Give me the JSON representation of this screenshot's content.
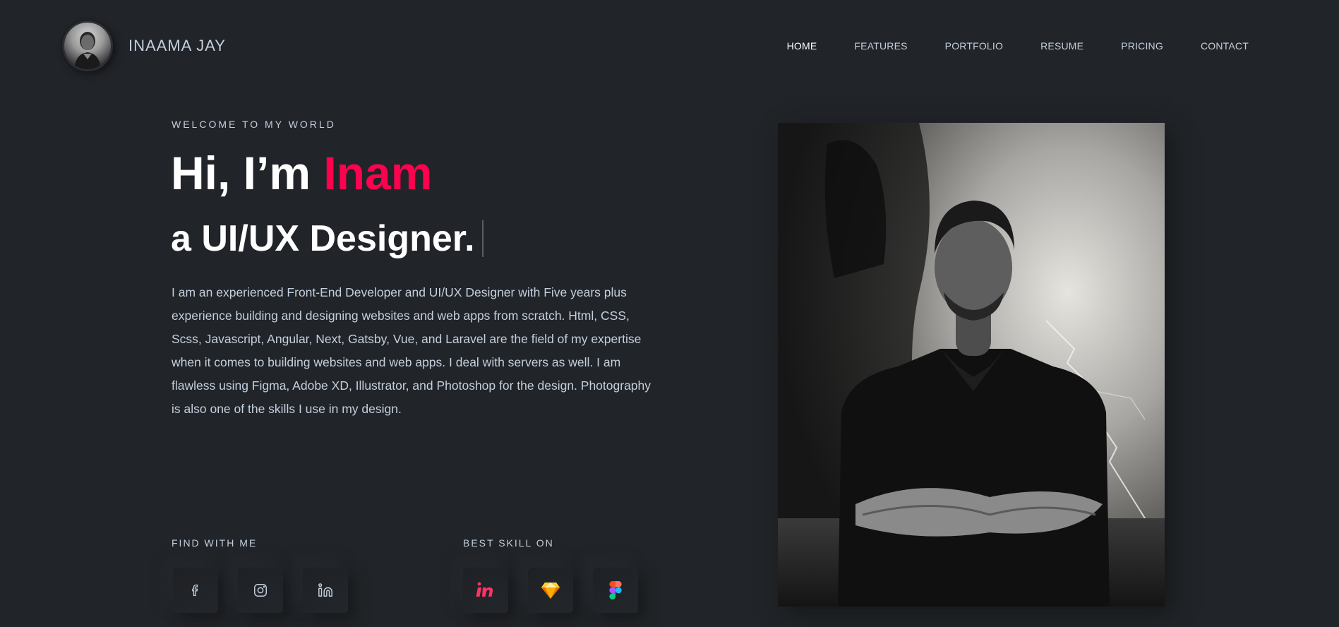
{
  "brand": {
    "name": "INAAMA JAY"
  },
  "nav": {
    "items": [
      {
        "label": "HOME",
        "active": true
      },
      {
        "label": "FEATURES",
        "active": false
      },
      {
        "label": "PORTFOLIO",
        "active": false
      },
      {
        "label": "RESUME",
        "active": false
      },
      {
        "label": "PRICING",
        "active": false
      },
      {
        "label": "CONTACT",
        "active": false
      }
    ]
  },
  "hero": {
    "welcome": "WELCOME TO MY WORLD",
    "greeting": "Hi, I’m ",
    "name": "Inam",
    "subtitle": "a UI/UX Designer.",
    "description": "I am an experienced Front-End Developer and UI/UX Designer with Five years plus experience building and designing websites and web apps from scratch. Html, CSS, Scss, Javascript, Angular, Next, Gatsby, Vue, and Laravel are the field of my expertise when it comes to building websites and web apps. I deal with servers as well. I am flawless using Figma, Adobe XD, Illustrator, and Photoshop for the design. Photography is also one of the skills I use in my design."
  },
  "social": {
    "label": "FIND WITH ME",
    "items": [
      {
        "icon": "facebook-icon"
      },
      {
        "icon": "instagram-icon"
      },
      {
        "icon": "linkedin-icon"
      }
    ]
  },
  "skills": {
    "label": "BEST SKILL ON",
    "items": [
      {
        "icon": "invision-icon"
      },
      {
        "icon": "sketch-icon"
      },
      {
        "icon": "figma-icon"
      }
    ]
  },
  "colors": {
    "background": "#212428",
    "accent": "#ff014f",
    "text": "#c4cfde",
    "heading": "#ffffff"
  }
}
